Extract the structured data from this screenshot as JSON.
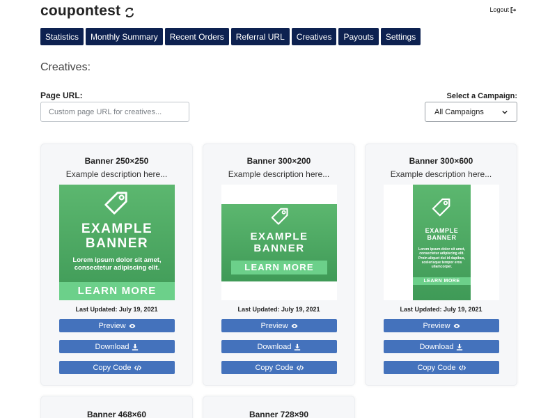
{
  "app": {
    "title": "coupontest",
    "logout_label": "Logout"
  },
  "nav": {
    "tabs": [
      "Statistics",
      "Monthly Summary",
      "Recent Orders",
      "Referral URL",
      "Creatives",
      "Payouts",
      "Settings"
    ]
  },
  "page": {
    "heading": "Creatives:"
  },
  "filters": {
    "page_url_label": "Page URL:",
    "page_url_placeholder": "Custom page URL for creatives...",
    "page_url_value": "",
    "campaign_label": "Select a Campaign:",
    "campaign_selected": "All Campaigns"
  },
  "banner_text": {
    "line1": "EXAMPLE",
    "line2": "BANNER",
    "body": "Lorem ipsum dolor sit amet, consectetur adipiscing elit.",
    "body_tall": "Lorem ipsum dolor sit amet, consectetur adipiscing elit. Proin aliquet dui id dapibus, scelerisque tempor eros ullamcorper.",
    "cta": "LEARN MORE"
  },
  "creatives": [
    {
      "title": "Banner 250×250",
      "description": "Example description here...",
      "updated": "Last Updated: July 19, 2021",
      "preview_label": "Preview",
      "download_label": "Download",
      "copy_label": "Copy Code"
    },
    {
      "title": "Banner 300×200",
      "description": "Example description here...",
      "updated": "Last Updated: July 19, 2021",
      "preview_label": "Preview",
      "download_label": "Download",
      "copy_label": "Copy Code"
    },
    {
      "title": "Banner 300×600",
      "description": "Example description here...",
      "updated": "Last Updated: July 19, 2021",
      "preview_label": "Preview",
      "download_label": "Download",
      "copy_label": "Copy Code"
    },
    {
      "title": "Banner 468×60"
    },
    {
      "title": "Banner 728×90"
    }
  ],
  "colors": {
    "nav_bg": "#0d2150",
    "button_bg": "#4472bc",
    "banner_green": "#4caf63",
    "banner_cta": "#6cd08a"
  },
  "icons": {
    "refresh": "refresh-icon",
    "logout": "sign-out-icon",
    "preview": "eye-icon",
    "download": "download-icon",
    "copy": "code-icon",
    "dropdown": "chevron-down-icon",
    "tag": "tag-icon"
  }
}
